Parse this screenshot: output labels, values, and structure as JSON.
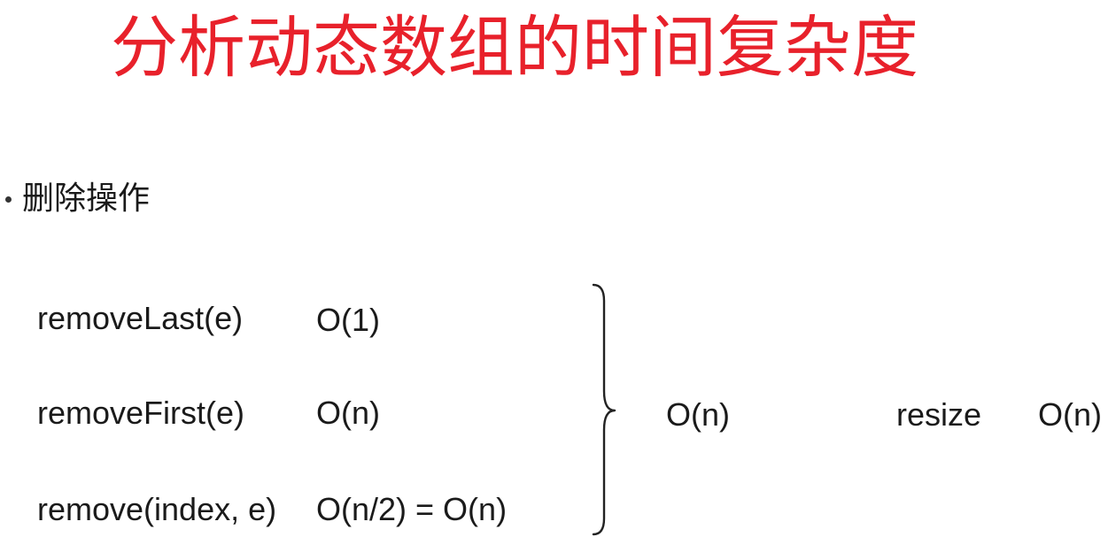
{
  "slide": {
    "title": "分析动态数组的时间复杂度",
    "bullet": "删除操作",
    "operations": [
      {
        "name": "removeLast(e)",
        "complexity": "O(1)"
      },
      {
        "name": "removeFirst(e)",
        "complexity": "O(n)"
      },
      {
        "name": "remove(index, e)",
        "complexity": "O(n/2) = O(n)"
      }
    ],
    "overall_complexity": "O(n)",
    "resize_label": "resize",
    "resize_complexity": "O(n)"
  },
  "colors": {
    "title": "#e8212b",
    "text": "#1a1a1a"
  }
}
